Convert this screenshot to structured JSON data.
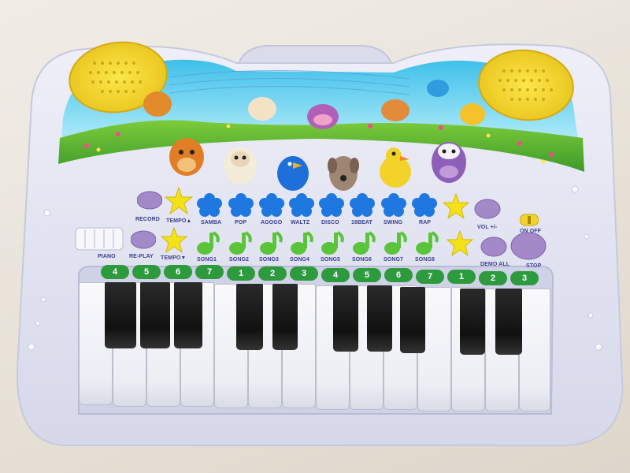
{
  "labels": {
    "record": "RECORD",
    "tempo_up": "TEMPO▲",
    "samba": "SAMBA",
    "pop": "POP",
    "agogo": "AGOGO",
    "waltz": "WALTZ",
    "disco": "DISCO",
    "beat16": "16BEAT",
    "swing": "SWING",
    "rap": "RAP",
    "vol": "VOL +/-",
    "on_off": "ON OFF",
    "piano": "PIANO",
    "replay": "RE-PLAY",
    "tempo_down": "TEMPO▼",
    "song1": "SONG1",
    "song2": "SONG2",
    "song3": "SONG3",
    "song4": "SONG4",
    "song5": "SONG5",
    "song6": "SONG6",
    "song7": "SONG7",
    "song8": "SONG8",
    "demo_all": "DEMO ALL",
    "stop": "STOP"
  },
  "note_numbers": [
    "4",
    "5",
    "6",
    "7",
    "1",
    "2",
    "3",
    "4",
    "5",
    "6",
    "7",
    "1",
    "2",
    "3"
  ],
  "colors": {
    "body": "#e6e7f3",
    "speaker": "#f2d22c",
    "star": "#f4e11a",
    "flower": "#1e78e0",
    "note": "#5ac43a",
    "purple": "#a489c9",
    "number_pill": "#2e9a3e",
    "label_text": "#3a3f8f"
  },
  "icons": {
    "animal_buttons": [
      "horse-icon",
      "sheep-icon",
      "bird-icon",
      "dog-icon",
      "duck-icon",
      "cow-icon"
    ]
  }
}
